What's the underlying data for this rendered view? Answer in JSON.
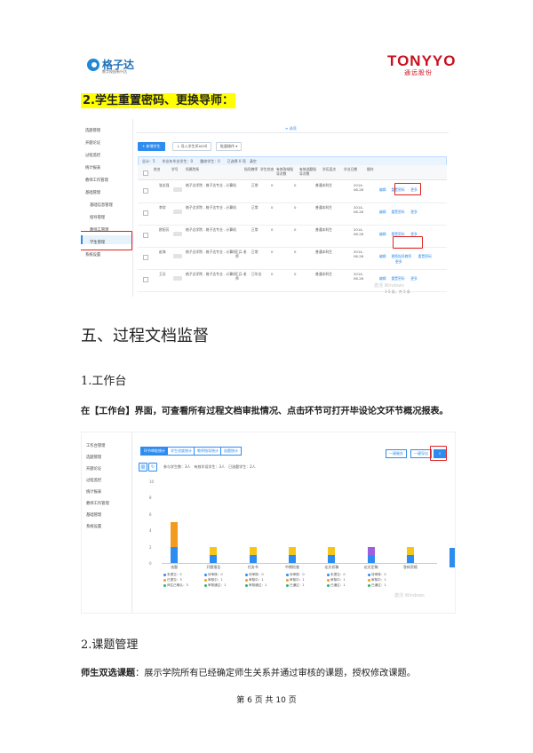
{
  "header": {
    "left_logo": {
      "name": "格子达",
      "slogan": "数字校园有兴达"
    },
    "right_logo": {
      "name": "TONYYO",
      "sub": "通远股份"
    }
  },
  "section_heading": "2.学生重置密码、更换导师：",
  "screenshot1": {
    "top_tab": "≡ 选项",
    "sidebar_items": [
      "选题管理",
      "开题论证",
      "过程监控",
      "统计报表",
      "教师工作管理",
      "基础管理",
      "基础信息管理",
      "指导管理",
      "教师工管理",
      "学生管理",
      "系统设置"
    ],
    "toolbar": {
      "add": "+ 新增学生",
      "import": "↓ 导入学生(Excel)",
      "batch": "批量操作 ▾"
    },
    "info_bar": "总计：5　　毕业年毕业学生：0　　重修学生：0　　已选择 0 项　清空",
    "columns": [
      "姓名",
      "学号",
      "所属院系",
      "指导教师",
      "学生状态",
      "有效答辩指导次数",
      "有效选题指导次数",
      "学历层次",
      "毕业日期",
      "操作"
    ],
    "rows": [
      {
        "name": "张志强",
        "dept": "格子达学院 - 格子达专业 - 计算机",
        "teacher": "",
        "status": "正常",
        "n1": "0",
        "n2": "0",
        "level": "普通本科生",
        "date": "2014-06-26",
        "actions": [
          "编辑",
          "重置密码",
          "更多"
        ]
      },
      {
        "name": "李欣",
        "dept": "格子达学院 - 格子达专业 - 计算机",
        "teacher": "",
        "status": "正常",
        "n1": "0",
        "n2": "0",
        "level": "普通本科生",
        "date": "2014-06-26",
        "actions": [
          "编辑",
          "重置密码",
          "更多"
        ]
      },
      {
        "name": "欧阳芳",
        "dept": "格子达学院 - 格子达专业 - 计算机",
        "teacher": "",
        "status": "正常",
        "n1": "0",
        "n2": "0",
        "level": "普通本科生",
        "date": "2014-06-26",
        "actions": [
          "编辑",
          "重置密码",
          "更多"
        ]
      },
      {
        "name": "赵海",
        "dept": "格子达学院 - 格子达专业 - 计算机",
        "teacher": "王兵 老师",
        "status": "正常",
        "n1": "0",
        "n2": "0",
        "level": "普通本科生",
        "date": "2014-06-26",
        "actions": [
          "编辑",
          "更换指导教师",
          "重置密码",
          "更多"
        ]
      },
      {
        "name": "王兵",
        "dept": "格子达学院 - 格子达专业 - 计算机",
        "teacher": "王兵 老师",
        "status": "已毕业",
        "n1": "0",
        "n2": "0",
        "level": "普通本科生",
        "date": "2014-06-26",
        "actions": [
          "编辑",
          "重置密码",
          "更多"
        ]
      }
    ],
    "watermark": "激活 Windows",
    "pager": "1-5 条，共 5 条"
  },
  "section_title": "五、过程文档监督",
  "sub1_title": "1.工作台",
  "sub1_text": "在【工作台】界面，可查看所有过程文档审批情况、点击环节可打开毕设论文环节概况报表。",
  "screenshot2": {
    "sidebar_items": [
      "工作台管理",
      "选题管理",
      "开题论证",
      "过程监控",
      "统计报表",
      "教师工作管理",
      "基础管理",
      "系统设置"
    ],
    "tabs": [
      "环节审批统计",
      "学生进度统计",
      "教师指导统计",
      "选题统计"
    ],
    "right_buttons": [
      "一键催办",
      "一键导出"
    ],
    "summary": "参与学生数：3人　有效毕设学生：3人　已选题学生：2人",
    "watermark": "激活 Windows"
  },
  "chart_data": {
    "type": "bar",
    "stacked": true,
    "categories": [
      "选题",
      "开题报告",
      "任务书",
      "中期检查",
      "论文初稿",
      "论文定稿",
      "答辩资格"
    ],
    "y_ticks": [
      "10",
      "8",
      "6",
      "4",
      "2",
      "0"
    ],
    "ylim": [
      0,
      10
    ],
    "series": [
      {
        "name": "未提交",
        "color": "#2d8cf0",
        "values": [
          2,
          1,
          1,
          1,
          1,
          1,
          1
        ]
      },
      {
        "name": "待审核",
        "color": "#f29b1f",
        "values": [
          3,
          0,
          0,
          0,
          0,
          0,
          0
        ]
      },
      {
        "name": "已通过",
        "color": "#f5c518",
        "values": [
          0,
          1,
          1,
          1,
          1,
          0,
          1
        ]
      },
      {
        "name": "已修改",
        "color": "#9c5fe0",
        "values": [
          0,
          0,
          0,
          0,
          0,
          1,
          0
        ]
      }
    ],
    "legend_rows": [
      [
        "未提交：0",
        "待审核：0",
        "待审核：0",
        "待审核：0",
        "未提交：0",
        "待审核：0"
      ],
      [
        "已提交：3",
        "审核中：1",
        "审核中：1",
        "审核中：1",
        "审核中：1",
        "审核中：1"
      ],
      [
        "师生已确认：3",
        "审核通过：1",
        "审核通过：1",
        "已通过：1",
        "已通过：1",
        "已通过：1"
      ]
    ]
  },
  "sub2_title": "2.课题管理",
  "sub2_bold": "师生双选课题",
  "sub2_text": "：展示学院所有已经确定师生关系并通过审核的课题，授权修改课题。",
  "footer": "第 6 页 共 10 页"
}
